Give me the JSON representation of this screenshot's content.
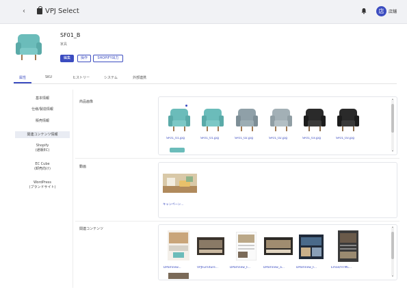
{
  "header": {
    "back_icon": "chevron-left-icon",
    "bag_icon": "shopping-bag-icon",
    "app_title": "VPJ Select",
    "bell_icon": "bell-icon",
    "avatar_initial": "店",
    "user_name": "店舗"
  },
  "product": {
    "code": "SF01_B",
    "subtitle": "家具",
    "buttons": {
      "edit": "編集",
      "operation": "操作",
      "shopify_export": "SHOPIFY出力"
    }
  },
  "tabs": [
    {
      "label": "属性",
      "active": true
    },
    {
      "label": "SKU",
      "active": false
    },
    {
      "label": "ヒストリー",
      "active": false
    },
    {
      "label": "システム",
      "active": false
    },
    {
      "label": "外部連携",
      "active": false
    }
  ],
  "sidenav": [
    {
      "label": "基本情報",
      "active": false
    },
    {
      "label": "仕様/製造情報",
      "active": false
    },
    {
      "label": "販売情報",
      "active": false
    },
    {
      "label": "関連コンテンツ情報",
      "active": true
    },
    {
      "label": "Shopify",
      "sub": "(通販EC)",
      "active": false
    },
    {
      "label": "EC Cube",
      "sub": "(卸売向け)",
      "active": false
    },
    {
      "label": "WordPress",
      "sub": "(ブランドサイト)",
      "active": false
    }
  ],
  "sections": {
    "product_images": {
      "label": "商品画像",
      "items": [
        {
          "caption": "SF01_01.jpg",
          "color": "#6bbcba"
        },
        {
          "caption": "SF01_01.jpg",
          "color": "#6bbcba"
        },
        {
          "caption": "SF01_02.jpg",
          "color": "#8fa0a8"
        },
        {
          "caption": "SF01_02.jpg",
          "color": "#a3b0b6"
        },
        {
          "caption": "SF01_03.jpg",
          "color": "#2a2a2a"
        },
        {
          "caption": "SF01_03.jpg",
          "color": "#2a2a2a"
        }
      ]
    },
    "banner": {
      "label": "動画",
      "items": [
        {
          "caption": "キャンペーン..."
        }
      ]
    },
    "related_content": {
      "label": "関連コンテンツ",
      "items": [
        {
          "caption": "DPamnew..."
        },
        {
          "caption": "VPJFurniture..."
        },
        {
          "caption": "DPamnew_F..."
        },
        {
          "caption": "DPamnew_a..."
        },
        {
          "caption": "DPamnew_F..."
        },
        {
          "caption": "Email/HTML..."
        }
      ]
    }
  },
  "colors": {
    "accent": "#3b4cc0",
    "topbar_bg": "#f1f2f5",
    "teal_chair": "#6bbcba"
  }
}
